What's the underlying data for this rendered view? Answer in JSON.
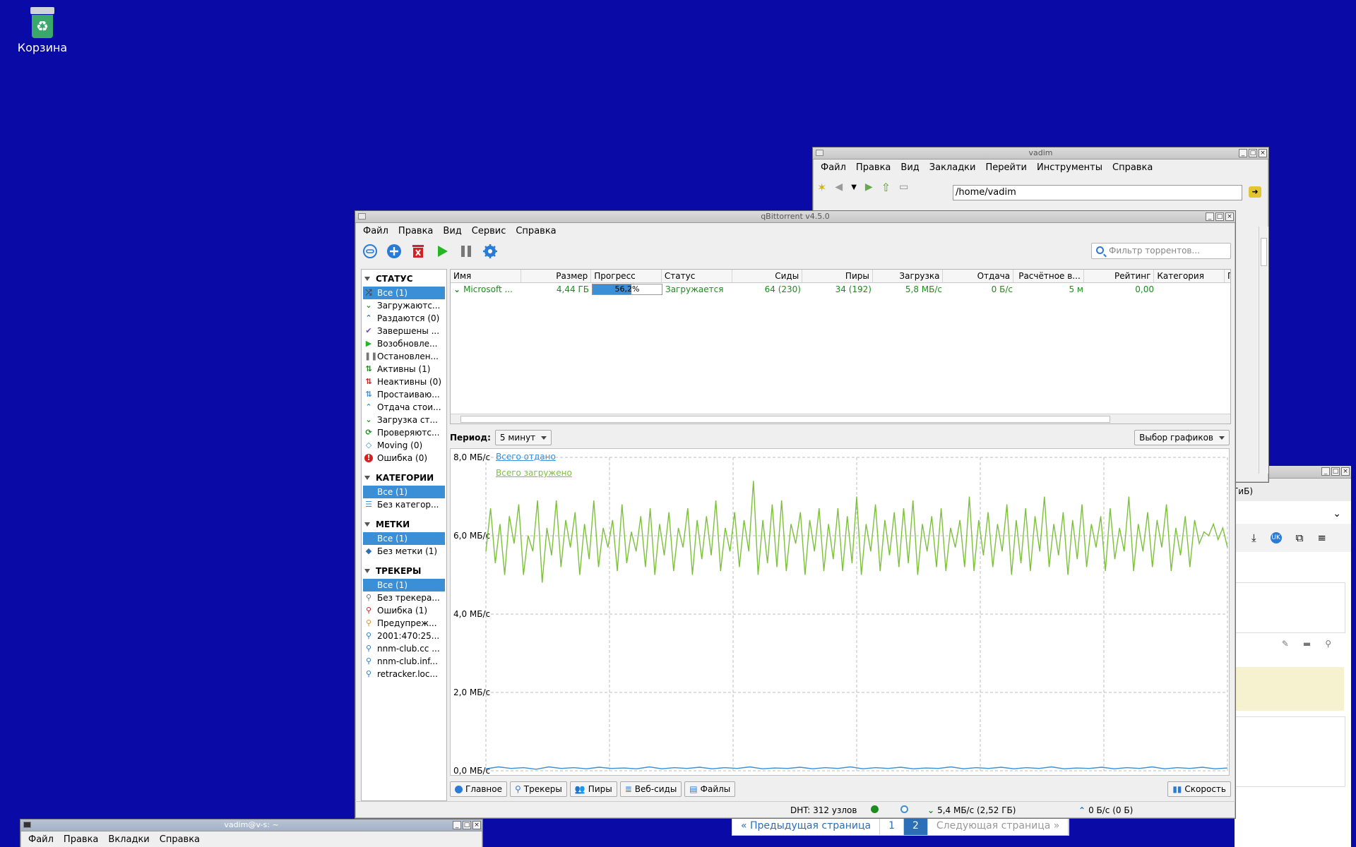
{
  "desktop": {
    "trash_label": "Корзина"
  },
  "file_manager": {
    "title": "vadim",
    "menu": [
      "Файл",
      "Правка",
      "Вид",
      "Закладки",
      "Перейти",
      "Инструменты",
      "Справка"
    ],
    "address": "/home/vadim"
  },
  "qbt": {
    "title": "qBittorrent v4.5.0",
    "menu": [
      "Файл",
      "Правка",
      "Вид",
      "Сервис",
      "Справка"
    ],
    "filter_placeholder": "Фильтр торрентов...",
    "sidebar": {
      "status_header": "СТАТУС",
      "status_items": [
        {
          "label": "Все (1)",
          "icon": "shuffle-icon",
          "color": "#4a4a4a"
        },
        {
          "label": "Загружаютс...",
          "icon": "download-chevron-icon",
          "color": "#1c8c1c"
        },
        {
          "label": "Раздаются (0)",
          "icon": "upload-chevron-icon",
          "color": "#2a6fb8"
        },
        {
          "label": "Завершены ...",
          "icon": "check-icon",
          "color": "#7b3fd1"
        },
        {
          "label": "Возобновле...",
          "icon": "play-icon",
          "color": "#25b525"
        },
        {
          "label": "Остановлен...",
          "icon": "pause-icon",
          "color": "#777777"
        },
        {
          "label": "Активны (1)",
          "icon": "active-arrows-icon",
          "color": "#1c8c1c"
        },
        {
          "label": "Неактивны (0)",
          "icon": "inactive-arrows-icon",
          "color": "#d42020"
        },
        {
          "label": "Простаиваю...",
          "icon": "stalled-arrows-icon",
          "color": "#3a8fd6"
        },
        {
          "label": "Отдача стои...",
          "icon": "upload-stalled-icon",
          "color": "#3a8fd6"
        },
        {
          "label": "Загрузка ст...",
          "icon": "download-stalled-icon",
          "color": "#1c8c1c"
        },
        {
          "label": "Проверяютс...",
          "icon": "refresh-icon",
          "color": "#1c8c1c"
        },
        {
          "label": "Moving (0)",
          "icon": "moving-icon",
          "color": "#3a8fd6"
        },
        {
          "label": "Ошибка (0)",
          "icon": "error-icon",
          "color": "#d42020"
        }
      ],
      "categories_header": "КАТЕГОРИИ",
      "categories_items": [
        {
          "label": "Все (1)",
          "icon": "none",
          "color": "#3a8fd6"
        },
        {
          "label": "Без категор...",
          "icon": "list-icon",
          "color": "#3a8fd6"
        }
      ],
      "tags_header": "МЕТКИ",
      "tags_items": [
        {
          "label": "Все (1)",
          "icon": "none",
          "color": "#3a8fd6"
        },
        {
          "label": "Без метки (1)",
          "icon": "tag-icon",
          "color": "#2a6fb8"
        }
      ],
      "trackers_header": "ТРЕКЕРЫ",
      "trackers_items": [
        {
          "label": "Все (1)",
          "icon": "none",
          "color": "#3a8fd6"
        },
        {
          "label": "Без трекера...",
          "icon": "pin-gray-icon",
          "color": "#777777"
        },
        {
          "label": "Ошибка (1)",
          "icon": "pin-red-icon",
          "color": "#d42020"
        },
        {
          "label": "Предупреж...",
          "icon": "pin-orange-icon",
          "color": "#e8901a"
        },
        {
          "label": "2001:470:25...",
          "icon": "pin-blue-icon",
          "color": "#2a7bd8"
        },
        {
          "label": "nnm-club.cc ...",
          "icon": "pin-blue-icon",
          "color": "#2a7bd8"
        },
        {
          "label": "nnm-club.inf...",
          "icon": "pin-blue-icon",
          "color": "#2a7bd8"
        },
        {
          "label": "retracker.loc...",
          "icon": "pin-blue-icon",
          "color": "#2a7bd8"
        }
      ]
    },
    "columns": [
      "Имя",
      "Размер",
      "Прогресс",
      "Статус",
      "Сиды",
      "Пиры",
      "Загрузка",
      "Отдача",
      "Расчётное в...",
      "Рейтинг",
      "Категория",
      "Г"
    ],
    "torrent": {
      "name": "Microsoft ...",
      "size": "4,44 ГБ",
      "progress_text": "56,2%",
      "progress": 0.562,
      "status": "Загружается",
      "seeds": "64 (230)",
      "peers": "34 (192)",
      "down": "5,8 МБ/с",
      "up": "0 Б/с",
      "eta": "5 м",
      "ratio": "0,00",
      "category": ""
    },
    "period_label": "Период:",
    "period_value": "5 минут",
    "graph_select": "Выбор графиков",
    "legend_up": "Всего отдано",
    "legend_down": "Всего загружено",
    "tabs": [
      "Главное",
      "Трекеры",
      "Пиры",
      "Веб-сиды",
      "Файлы"
    ],
    "speed_button": "Скорость",
    "status_bar": {
      "dht": "DHT: 312 узлов",
      "down": "5,4 МБ/с (2,52 ГБ)",
      "up": "0 Б/с (0 Б)"
    }
  },
  "chart_data": {
    "type": "line",
    "title": "",
    "xlabel": "",
    "ylabel": "",
    "y_tick_labels": [
      "8,0 МБ/с",
      "6,0 МБ/с",
      "4,0 МБ/с",
      "2,0 МБ/с",
      "0,0 МБ/с"
    ],
    "ylim": [
      0,
      8
    ],
    "grid": true,
    "legend_position": "top-left",
    "series": [
      {
        "name": "Всего загружено",
        "color": "#7cc13a",
        "values": [
          5.6,
          6.7,
          5.3,
          6.3,
          5.0,
          6.5,
          5.8,
          6.8,
          5.0,
          6.0,
          5.6,
          6.9,
          4.8,
          6.2,
          5.5,
          6.9,
          5.2,
          6.4,
          5.7,
          6.6,
          5.0,
          6.3,
          5.4,
          6.9,
          5.2,
          6.2,
          5.7,
          6.4,
          5.1,
          6.8,
          5.3,
          6.1,
          5.6,
          6.5,
          5.2,
          6.7,
          5.0,
          6.3,
          5.5,
          6.6,
          5.1,
          6.2,
          5.7,
          6.7,
          5.0,
          6.4,
          5.4,
          6.5,
          5.5,
          6.9,
          5.1,
          6.2,
          5.6,
          6.6,
          5.2,
          6.4,
          5.6,
          7.4,
          5.0,
          6.4,
          5.3,
          6.8,
          5.2,
          6.9,
          5.1,
          6.3,
          5.8,
          6.6,
          5.0,
          6.4,
          5.6,
          6.7,
          5.1,
          6.3,
          5.4,
          6.7,
          5.1,
          6.5,
          5.3,
          7.0,
          5.0,
          6.3,
          5.6,
          6.8,
          5.1,
          6.4,
          5.5,
          6.6,
          5.2,
          6.7,
          5.3,
          6.9,
          5.0,
          6.3,
          5.6,
          6.5,
          5.2,
          6.7,
          5.1,
          6.2,
          5.7,
          6.4,
          5.2,
          7.0,
          5.1,
          6.4,
          5.5,
          6.6,
          5.2,
          6.3,
          5.6,
          6.8,
          5.0,
          6.4,
          5.3,
          6.7,
          5.1,
          6.5,
          5.6,
          7.0,
          5.2,
          6.3,
          5.5,
          6.6,
          5.0,
          6.4,
          5.4,
          6.8,
          5.2,
          6.3,
          5.7,
          6.5,
          5.1,
          6.7,
          5.4,
          6.2,
          5.6,
          7.0,
          5.1,
          6.3,
          5.6,
          6.6,
          5.2,
          6.4,
          5.7,
          6.8,
          5.1,
          6.2,
          5.5,
          6.5,
          5.2,
          6.4,
          5.8,
          6.1,
          6.0,
          6.3,
          5.9,
          6.2,
          5.7
        ]
      },
      {
        "name": "Всего отдано",
        "color": "#3a8fd6",
        "values": [
          0.05,
          0.1,
          0.06,
          0.08,
          0.04,
          0.1,
          0.06,
          0.08,
          0.05,
          0.09,
          0.06,
          0.07,
          0.05,
          0.1,
          0.05,
          0.08,
          0.06,
          0.09,
          0.05,
          0.08,
          0.06,
          0.1,
          0.05,
          0.07,
          0.06,
          0.09,
          0.05,
          0.08,
          0.06,
          0.1,
          0.05,
          0.08,
          0.06,
          0.09,
          0.05,
          0.07,
          0.06,
          0.1,
          0.05,
          0.08,
          0.06,
          0.09,
          0.05,
          0.08,
          0.06,
          0.1,
          0.05,
          0.07,
          0.06,
          0.09,
          0.05,
          0.08,
          0.06,
          0.1,
          0.05,
          0.08,
          0.06,
          0.09,
          0.05,
          0.07
        ]
      }
    ]
  },
  "terminal": {
    "title": "vadim@v-s: ~",
    "menu": [
      "Файл",
      "Правка",
      "Вкладки",
      "Справка"
    ]
  },
  "browser_bg": {
    "pager": [
      "« Предыдущая страница",
      "1",
      "2",
      "Следующая страница »"
    ],
    "size_hint": "ГиБ)"
  }
}
